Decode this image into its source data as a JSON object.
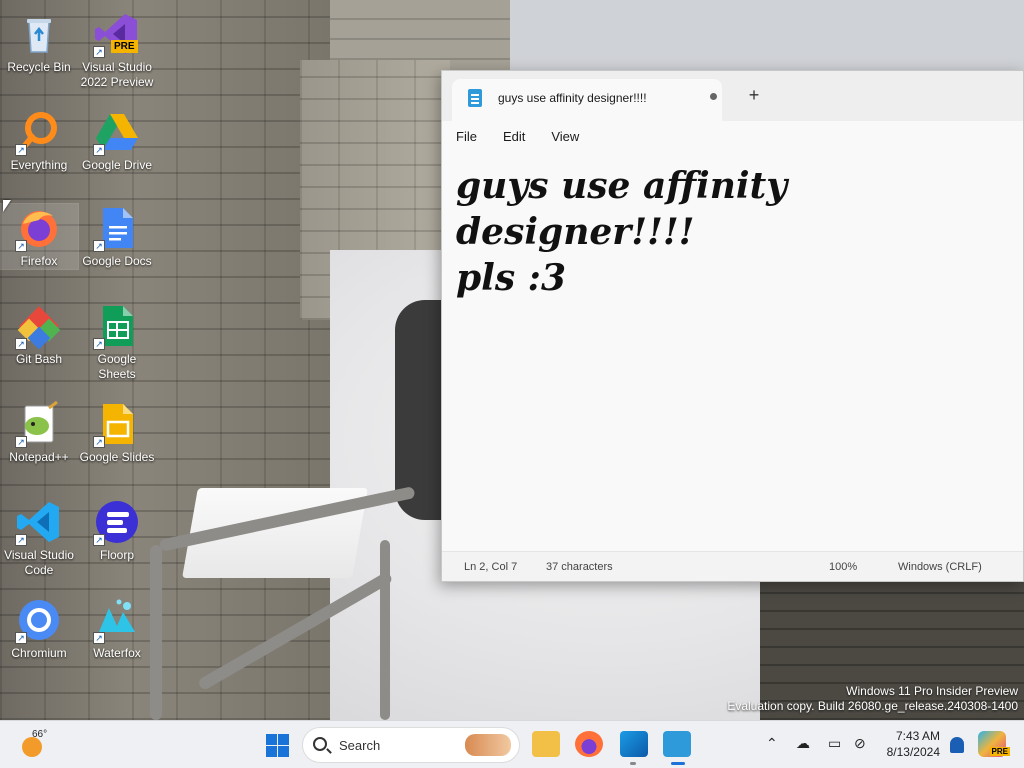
{
  "desktop": {
    "icons": [
      {
        "label": "Recycle Bin",
        "icon": "recycle-bin-icon",
        "color": "#3a86d6"
      },
      {
        "label": "Visual Studio 2022 Preview",
        "icon": "visual-studio-preview-icon",
        "badge": "PRE",
        "color": "#7b3fc7"
      },
      {
        "label": "Everything",
        "icon": "everything-search-icon",
        "color": "#ff8c1a"
      },
      {
        "label": "Google Drive",
        "icon": "google-drive-icon",
        "color": "#1ea362"
      },
      {
        "label": "Firefox",
        "icon": "firefox-icon",
        "color": "#ff7139"
      },
      {
        "label": "Google Docs",
        "icon": "google-docs-icon",
        "color": "#4285f4"
      },
      {
        "label": "Git Bash",
        "icon": "git-bash-icon",
        "color": "#e8473b"
      },
      {
        "label": "Google Sheets",
        "icon": "google-sheets-icon",
        "color": "#0f9d58"
      },
      {
        "label": "Notepad++",
        "icon": "notepad-plus-plus-icon",
        "color": "#8bc34a"
      },
      {
        "label": "Google Slides",
        "icon": "google-slides-icon",
        "color": "#f4b400"
      },
      {
        "label": "Visual Studio Code",
        "icon": "vscode-icon",
        "color": "#23a9f2"
      },
      {
        "label": "Floorp",
        "icon": "floorp-icon",
        "color": "#3b2fd6"
      },
      {
        "label": "Chromium",
        "icon": "chromium-icon",
        "color": "#4a8af4"
      },
      {
        "label": "Waterfox",
        "icon": "waterfox-icon",
        "color": "#2ec4e8"
      }
    ]
  },
  "notepad": {
    "tab_title": "guys use affinity designer!!!!",
    "menu": [
      "File",
      "Edit",
      "View"
    ],
    "content": "guys use affinity designer!!!!\npls :3",
    "status": {
      "position": "Ln 2, Col 7",
      "characters": "37 characters",
      "zoom": "100%",
      "line_ending": "Windows (CRLF)"
    }
  },
  "watermark": {
    "line1": "Windows 11 Pro Insider Preview",
    "line2": "Evaluation copy. Build 26080.ge_release.240308-1400"
  },
  "taskbar": {
    "weather_temp": "66°",
    "search_placeholder": "Search",
    "time": "7:43 AM",
    "date": "8/13/2024",
    "copilot_badge": "PRE"
  }
}
